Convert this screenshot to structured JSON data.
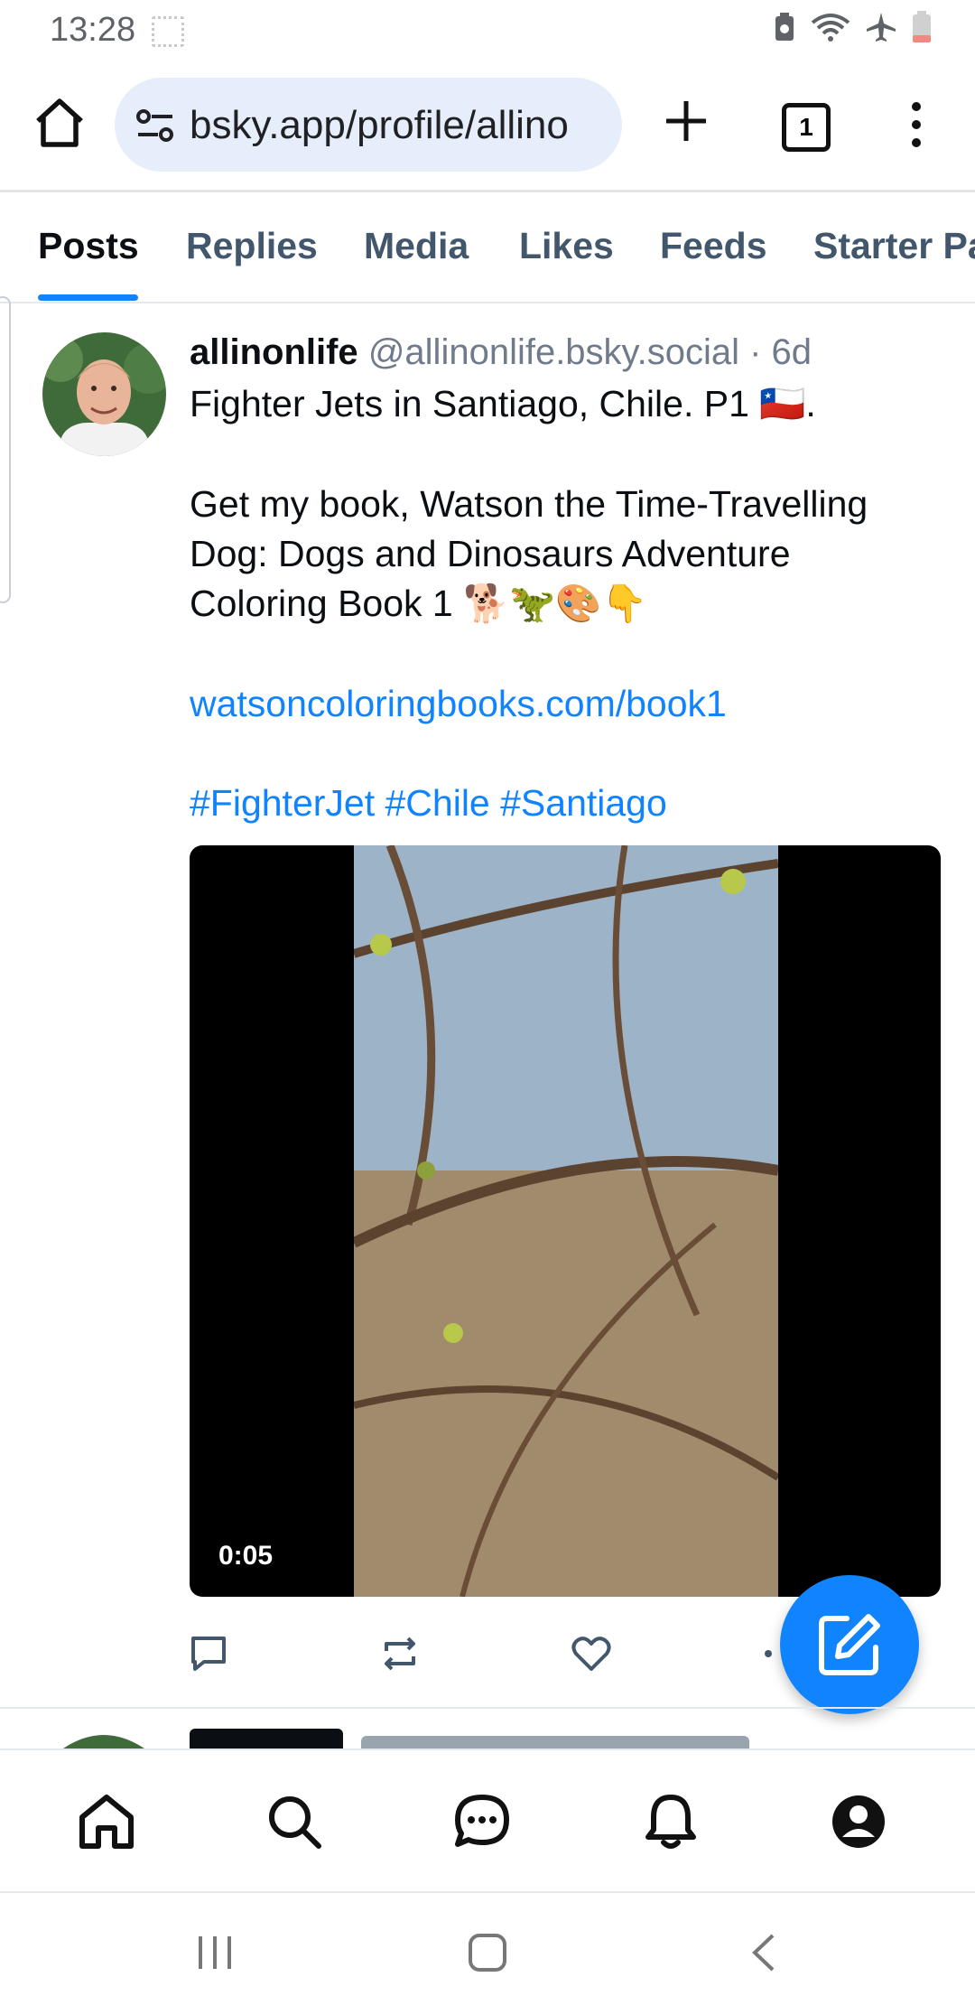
{
  "status_bar": {
    "time": "13:28"
  },
  "browser": {
    "url": "bsky.app/profile/allino",
    "tab_count": "1"
  },
  "profile_tabs": [
    "Posts",
    "Replies",
    "Media",
    "Likes",
    "Feeds",
    "Starter Pa"
  ],
  "post": {
    "author_name": "allinonlife",
    "author_handle": "@allinonlife.bsky.social",
    "age": "· 6d",
    "line1": "Fighter Jets in Santiago, Chile. P1 🇨🇱.",
    "line2": "Get my book, Watson the Time-Travelling",
    "line3": "Dog: Dogs and Dinosaurs Adventure",
    "line4": "Coloring Book 1 🐕🦖🎨👇",
    "link": "watsoncoloringbooks.com/book1",
    "hashtags": "#FighterJet #Chile #Santiago",
    "video_duration": "0:05"
  },
  "colors": {
    "accent": "#1083fe",
    "tab_text": "#42576c",
    "handle": "#6f7b8a"
  }
}
